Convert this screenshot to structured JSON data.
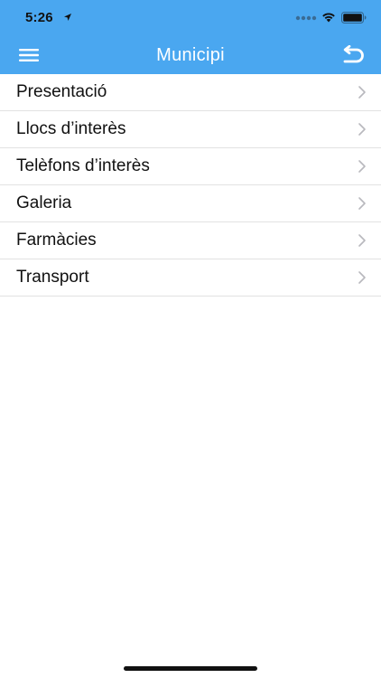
{
  "status_bar": {
    "time": "5:26"
  },
  "navbar": {
    "title": "Municipi",
    "menu_icon": "hamburger-menu-icon",
    "back_icon": "undo-return-icon"
  },
  "menu": {
    "items": [
      {
        "label": "Presentació"
      },
      {
        "label": "Llocs d’interès"
      },
      {
        "label": "Telèfons d’interès"
      },
      {
        "label": "Galeria"
      },
      {
        "label": "Farmàcies"
      },
      {
        "label": "Transport"
      }
    ]
  },
  "colors": {
    "accent": "#4aa7f0",
    "background": "#ffffff",
    "text": "#111111",
    "divider": "#e2e2e2",
    "chevron": "#b8b8bd"
  }
}
